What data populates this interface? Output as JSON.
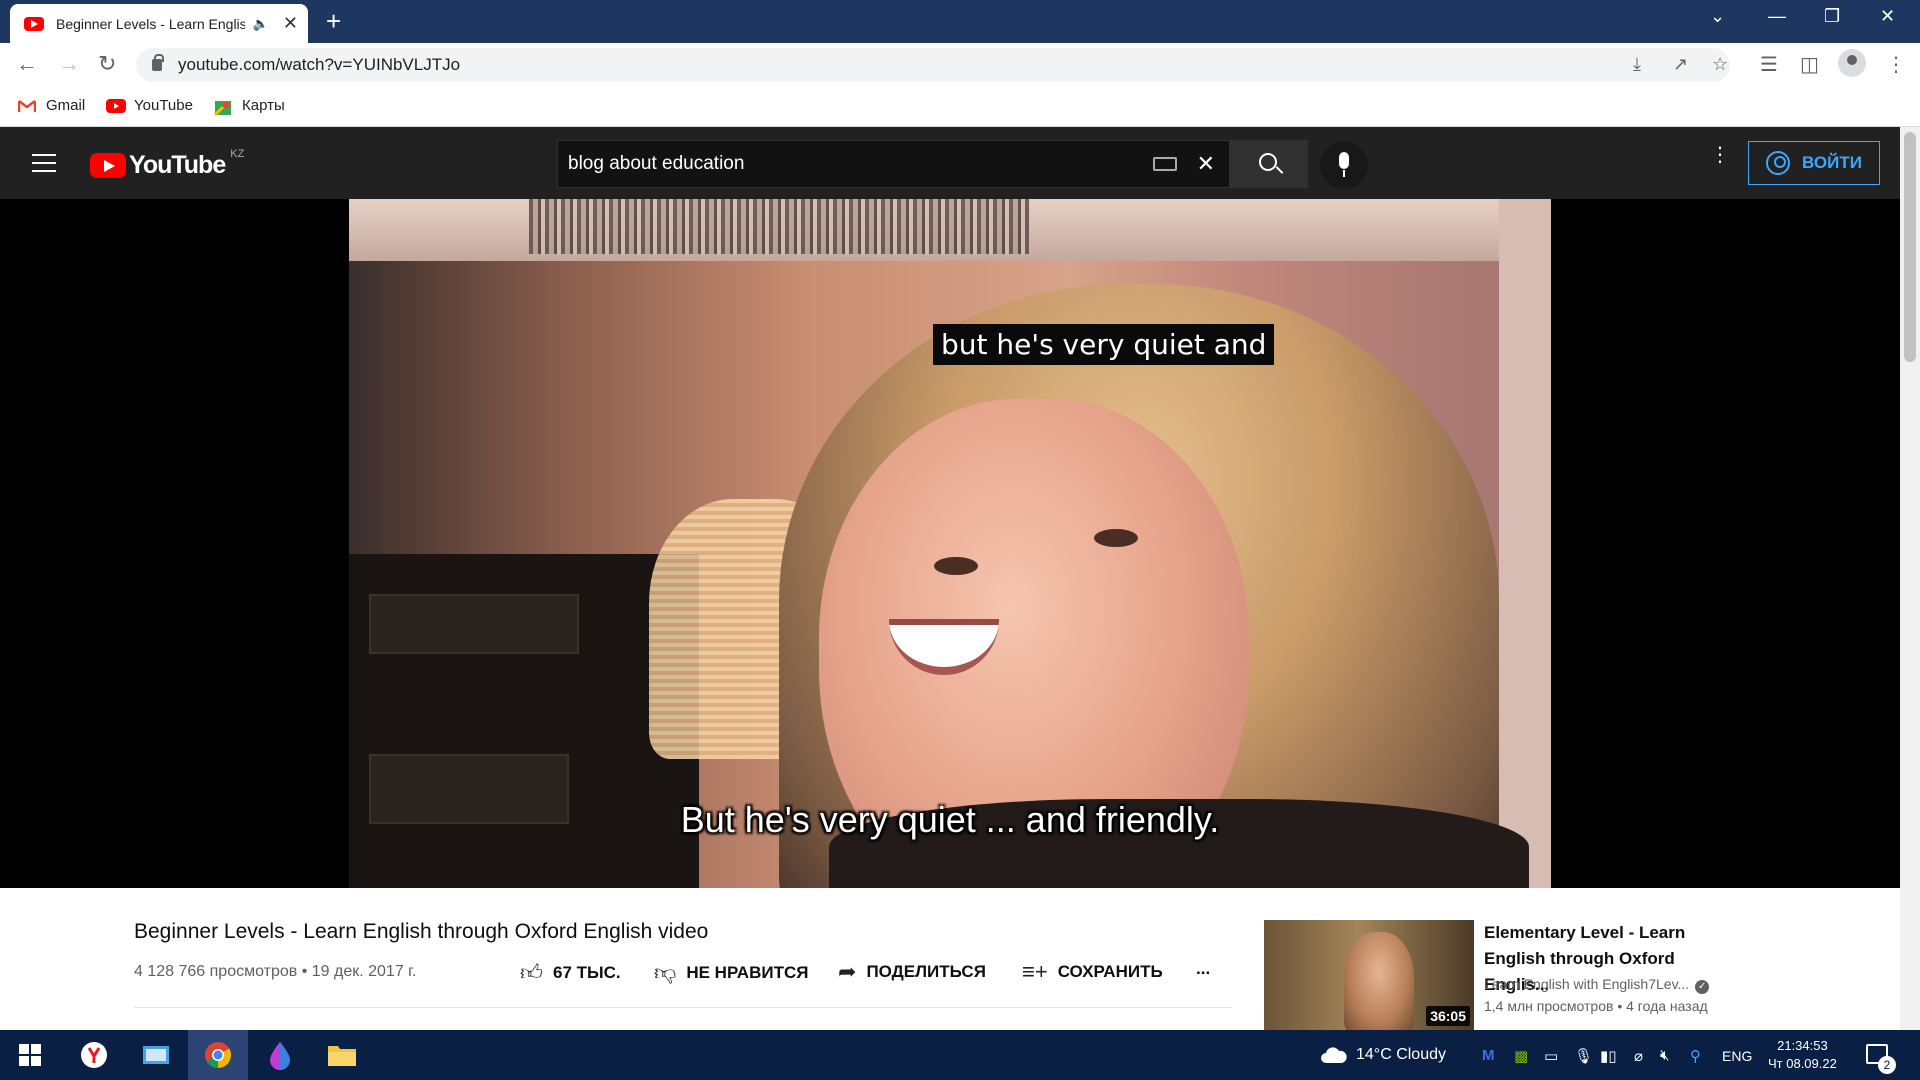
{
  "browser": {
    "tab_title": "Beginner Levels - Learn English through Oxford English video",
    "url": "youtube.com/watch?v=YUINbVLJTJo",
    "bookmarks": [
      {
        "label": "Gmail",
        "icon": "gmail-icon"
      },
      {
        "label": "YouTube",
        "icon": "youtube-icon"
      },
      {
        "label": "Карты",
        "icon": "maps-icon"
      }
    ]
  },
  "youtube": {
    "region": "KZ",
    "logo_text": "YouTube",
    "search_query": "blog about education",
    "sign_in_label": "ВОЙТИ",
    "subtitle_top": "but he's very quiet and",
    "subtitle_bottom": "But he's very quiet ... and friendly.",
    "video": {
      "title": "Beginner Levels - Learn English through Oxford English video",
      "views_date": "4 128 766 просмотров • 19 дек. 2017 г.",
      "likes": "67 ТЫС.",
      "dislike_label": "НЕ НРАВИТСЯ",
      "share_label": "ПОДЕЛИТЬСЯ",
      "save_label": "СОХРАНИТЬ",
      "more_label": "..."
    },
    "recommendation": {
      "title": "Elementary Level - Learn English through Oxford Englis...",
      "channel": "Learn English with English7Lev...",
      "stats": "1,4 млн просмотров • 4 года назад",
      "duration": "36:05"
    }
  },
  "taskbar": {
    "weather": "14°C  Cloudy",
    "language": "ENG",
    "time": "21:34:53",
    "date": "Чт 08.09.22",
    "notifications": "2"
  },
  "colors": {
    "titlebar": "#1e3760",
    "youtube_red": "#ff0000",
    "yt_header": "#212121",
    "signin_blue": "#3ea6ff",
    "taskbar": "#0a1f44"
  }
}
